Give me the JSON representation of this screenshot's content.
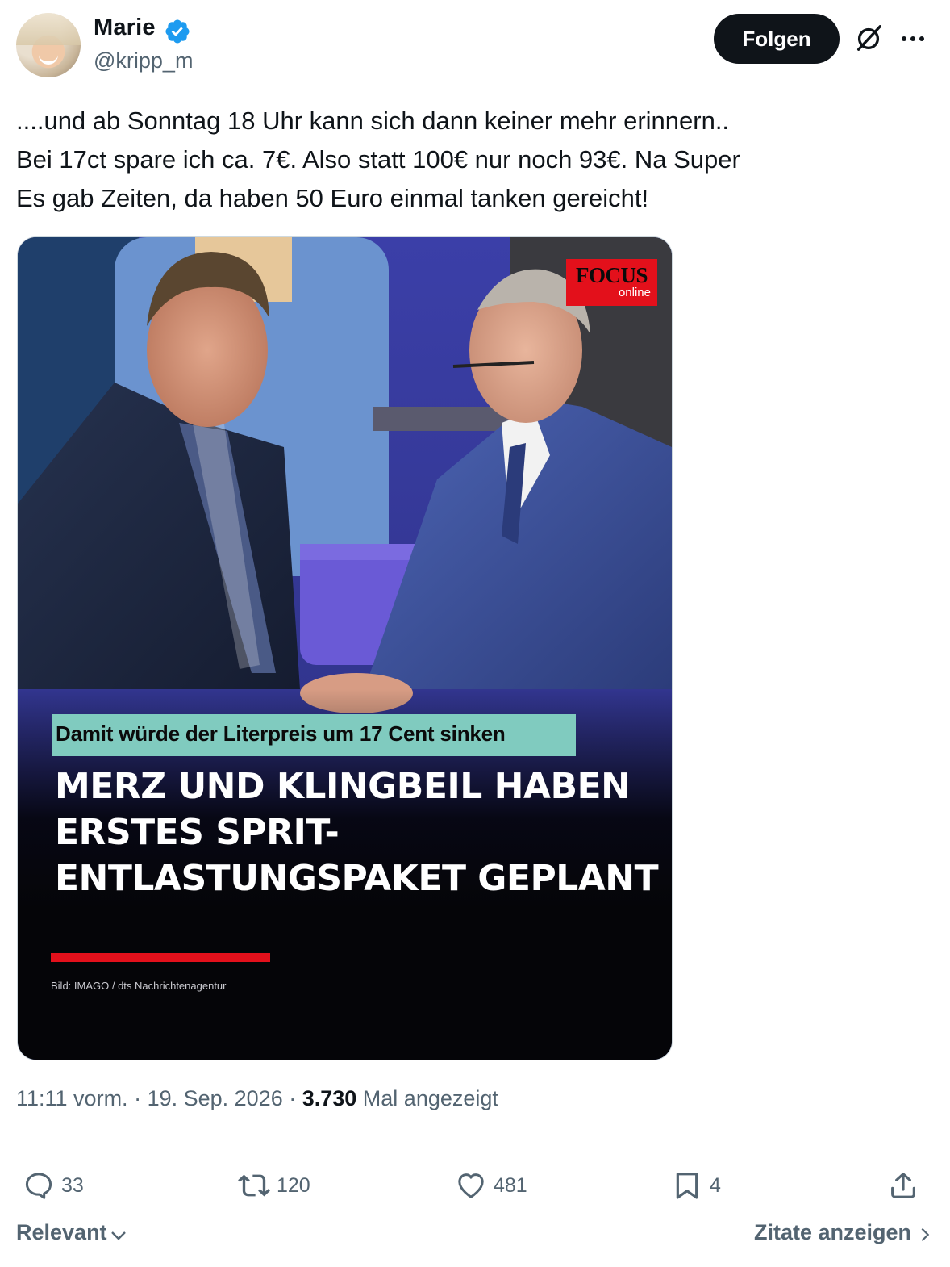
{
  "author": {
    "name": "Marie",
    "handle": "@kripp_m",
    "verified": true,
    "verified_color": "#1d9bf0"
  },
  "header": {
    "follow_label": "Folgen",
    "icons": [
      "grok-icon",
      "more-icon"
    ]
  },
  "tweet": {
    "lines": [
      "....und ab Sonntag 18 Uhr kann sich dann keiner mehr erinnern..",
      "Bei 17ct spare ich ca. 7€. Also statt 100€ nur noch 93€. Na Super",
      "Es gab Zeiten, da haben 50 Euro einmal tanken gereicht!"
    ]
  },
  "media": {
    "logo_brand": "FOCUS",
    "logo_sub": "online",
    "banner": "Damit würde der Literpreis um 17 Cent sinken",
    "headline": [
      "MERZ UND KLINGBEIL HABEN",
      "ERSTES SPRIT-",
      "ENTLASTUNGSPAKET GEPLANT"
    ],
    "credit": "Bild: IMAGO / dts Nachrichtenagentur",
    "accent_color": "#e3101b",
    "banner_color": "#80cbbf"
  },
  "meta": {
    "time": "11:11 vorm.",
    "sep1": " · ",
    "date": "19. Sep. 2026",
    "sep2": " · ",
    "views": "3.730",
    "views_label": " Mal angezeigt"
  },
  "actions": {
    "replies": "33",
    "retweets": "120",
    "likes": "481",
    "bookmarks": "4"
  },
  "footer": {
    "sort_label": "Relevant",
    "quotes_label": "Zitate anzeigen"
  }
}
